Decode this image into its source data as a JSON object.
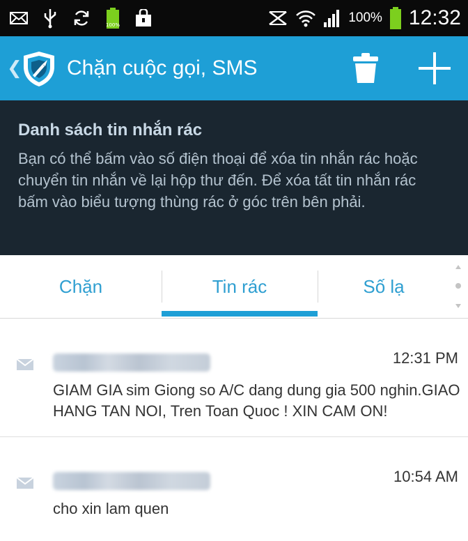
{
  "status_bar": {
    "icons": [
      "mail-icon",
      "usb-icon",
      "sync-icon",
      "battery-full-icon",
      "shopping-bag-icon",
      "nfc-icon",
      "wifi-icon",
      "signal-icon",
      "battery-icon"
    ],
    "battery_percent": "100%",
    "time": "12:32"
  },
  "action_bar": {
    "title": "Chặn cuộc gọi, SMS",
    "color": "#1e9fd6"
  },
  "info_panel": {
    "title": "Danh sách tin nhắn rác",
    "description": "Bạn có thể bấm vào số điện thoại để xóa tin nhắn rác hoặc chuyển tin nhắn về lại hộp thư đến. Để xóa tất tin nhắn rác bấm vào biểu tượng thùng rác ở góc trên bên phải."
  },
  "tabs": [
    {
      "label": "Chặn",
      "selected": false
    },
    {
      "label": "Tin rác",
      "selected": true
    },
    {
      "label": "Số lạ",
      "selected": false
    }
  ],
  "messages": [
    {
      "sender": "",
      "time": "12:31 PM",
      "body": "GIAM GIA sim Giong so A/C dang dung gia 500 nghin.GIAO HANG TAN NOI, Tren Toan Quoc ! XIN CAM ON!"
    },
    {
      "sender": "",
      "time": "10:54 AM",
      "body": "cho xin lam quen"
    }
  ]
}
